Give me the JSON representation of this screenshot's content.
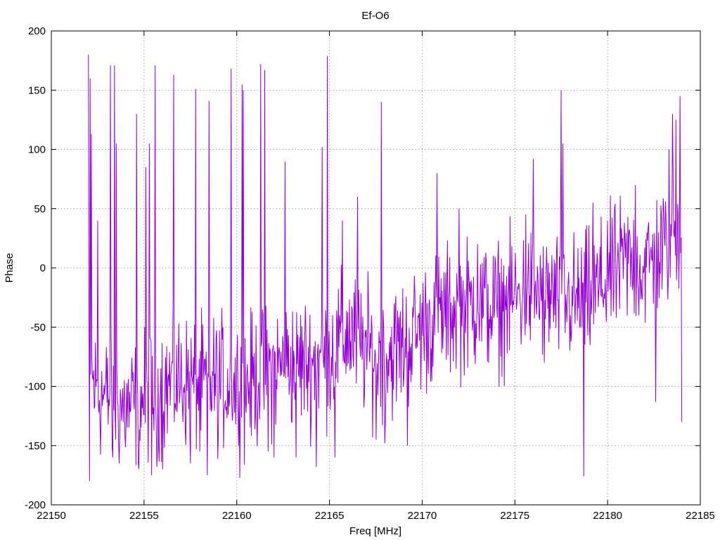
{
  "chart_data": {
    "type": "line",
    "title": "Ef-O6",
    "xlabel": "Freq [MHz]",
    "ylabel": "Phase",
    "xlim": [
      22150,
      22185
    ],
    "ylim": [
      -200,
      200
    ],
    "xticks": [
      22150,
      22155,
      22160,
      22165,
      22170,
      22175,
      22180,
      22185
    ],
    "yticks": [
      -200,
      -150,
      -100,
      -50,
      0,
      50,
      100,
      150,
      200
    ],
    "grid": true,
    "legend": "none",
    "series_color": "#9400d3",
    "x_start": 22152,
    "x_end": 22184,
    "point_count": 1024,
    "trend": [
      [
        22152.0,
        -90
      ],
      [
        22152.5,
        -105
      ],
      [
        22153.0,
        -110
      ],
      [
        22154.0,
        -120
      ],
      [
        22155.0,
        -110
      ],
      [
        22156.0,
        -100
      ],
      [
        22157.0,
        -95
      ],
      [
        22158.0,
        -100
      ],
      [
        22159.0,
        -95
      ],
      [
        22160.0,
        -100
      ],
      [
        22161.0,
        -95
      ],
      [
        22162.0,
        -85
      ],
      [
        22163.0,
        -80
      ],
      [
        22164.0,
        -80
      ],
      [
        22165.0,
        -75
      ],
      [
        22166.0,
        -55
      ],
      [
        22167.0,
        -70
      ],
      [
        22168.0,
        -75
      ],
      [
        22169.0,
        -65
      ],
      [
        22170.0,
        -50
      ],
      [
        22171.0,
        -40
      ],
      [
        22172.0,
        -35
      ],
      [
        22173.0,
        -30
      ],
      [
        22174.0,
        -35
      ],
      [
        22175.0,
        -25
      ],
      [
        22176.0,
        -20
      ],
      [
        22177.0,
        -25
      ],
      [
        22178.0,
        -30
      ],
      [
        22179.0,
        -25
      ],
      [
        22180.0,
        -10
      ],
      [
        22181.0,
        5
      ],
      [
        22182.0,
        0
      ],
      [
        22183.0,
        15
      ],
      [
        22183.5,
        30
      ],
      [
        22184.0,
        40
      ]
    ],
    "spikes": [
      [
        22152.0,
        180
      ],
      [
        22152.05,
        -180
      ],
      [
        22152.1,
        160
      ],
      [
        22152.15,
        113
      ],
      [
        22152.5,
        40
      ],
      [
        22153.2,
        171
      ],
      [
        22153.3,
        -160
      ],
      [
        22153.4,
        171
      ],
      [
        22153.5,
        105
      ],
      [
        22154.6,
        130
      ],
      [
        22154.7,
        -165
      ],
      [
        22155.1,
        85
      ],
      [
        22155.3,
        105
      ],
      [
        22155.4,
        -175
      ],
      [
        22155.6,
        171
      ],
      [
        22155.7,
        -168
      ],
      [
        22156.0,
        -170
      ],
      [
        22156.6,
        163
      ],
      [
        22157.5,
        -165
      ],
      [
        22157.8,
        151
      ],
      [
        22158.0,
        -155
      ],
      [
        22158.5,
        141
      ],
      [
        22158.4,
        -175
      ],
      [
        22159.0,
        -140
      ],
      [
        22159.7,
        168
      ],
      [
        22160.1,
        -150
      ],
      [
        22160.3,
        155
      ],
      [
        22160.35,
        150
      ],
      [
        22160.4,
        -166
      ],
      [
        22161.3,
        172
      ],
      [
        22161.5,
        167
      ],
      [
        22161.7,
        -155
      ],
      [
        22162.0,
        -160
      ],
      [
        22162.6,
        90
      ],
      [
        22163.2,
        -160
      ],
      [
        22164.3,
        -168
      ],
      [
        22164.9,
        179
      ],
      [
        22164.6,
        102
      ],
      [
        22165.3,
        -160
      ],
      [
        22165.7,
        40
      ],
      [
        22166.5,
        60
      ],
      [
        22167.5,
        -145
      ],
      [
        22167.8,
        140
      ],
      [
        22168.0,
        -148
      ],
      [
        22169.2,
        -150
      ],
      [
        22170.8,
        80
      ],
      [
        22171.6,
        -60
      ],
      [
        22172.0,
        50
      ],
      [
        22173.0,
        20
      ],
      [
        22174.5,
        -30
      ],
      [
        22175.6,
        45
      ],
      [
        22176.0,
        92
      ],
      [
        22176.6,
        -80
      ],
      [
        22177.5,
        150
      ],
      [
        22177.6,
        105
      ],
      [
        22178.0,
        -40
      ],
      [
        22178.7,
        -176
      ],
      [
        22179.2,
        55
      ],
      [
        22180.0,
        40
      ],
      [
        22180.8,
        25
      ],
      [
        22181.5,
        70
      ],
      [
        22182.6,
        -113
      ],
      [
        22183.3,
        100
      ],
      [
        22183.5,
        130
      ],
      [
        22183.7,
        125
      ],
      [
        22183.9,
        145
      ],
      [
        22184.0,
        180
      ],
      [
        22184.0,
        -130
      ]
    ]
  }
}
